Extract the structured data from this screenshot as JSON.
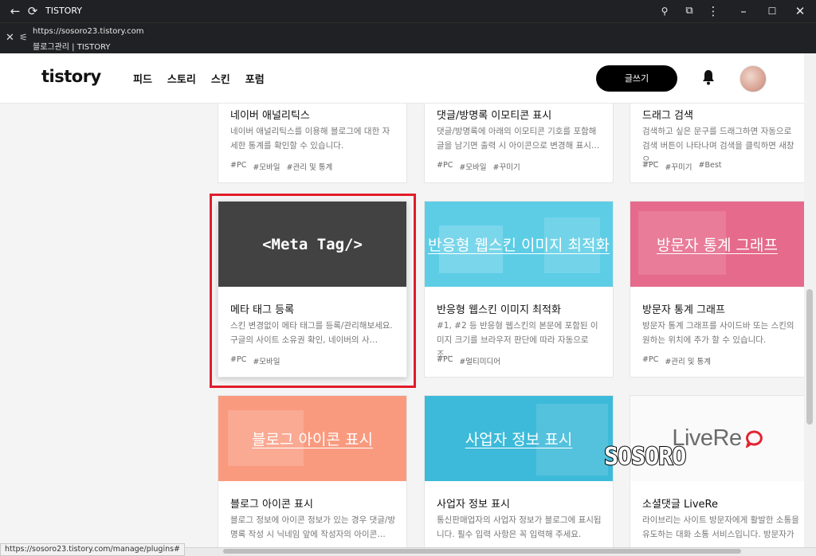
{
  "browser": {
    "window_title": "TISTORY",
    "url": "https://sosoro23.tistory.com",
    "page_title": "블로그관리 | TISTORY",
    "status_url": "https://sosoro23.tistory.com/manage/plugins#"
  },
  "header": {
    "logo": "tistory",
    "nav": [
      "피드",
      "스토리",
      "스킨",
      "포럼"
    ],
    "write_label": "글쓰기"
  },
  "cards": [
    {
      "name": "네이버 애널리틱스",
      "desc": "네이버 애널리틱스를 이용해 블로그에 대한 자세한 통계를 확인할 수 있습니다.",
      "tags": [
        "#PC",
        "#모바일",
        "#관리 및 통계"
      ]
    },
    {
      "name": "댓글/방명록 이모티콘 표시",
      "desc": "댓글/방명록에 아래의 이모티콘 기호를 포함해 글을 남기면 출력 시 아이콘으로 변경해 표시…",
      "tags": [
        "#PC",
        "#모바일",
        "#꾸미기"
      ]
    },
    {
      "name": "드래그 검색",
      "desc": "검색하고 싶은 문구를 드래그하면 자동으로 검색 버튼이 나타나며 검색을 클릭하면 새창으…",
      "tags": [
        "#PC",
        "#꾸미기",
        "#Best"
      ]
    },
    {
      "thumb": "<Meta Tag/>",
      "name": "메타 태그 등록",
      "desc": "스킨 변경없이 메타 태그를 등록/관리해보세요. 구글의 사이트 소유권 확인, 네이버의 사…",
      "tags": [
        "#PC",
        "#모바일"
      ]
    },
    {
      "thumb": "반응형 웹스킨 이미지 최적화",
      "name": "반응형 웹스킨 이미지 최적화",
      "desc": "#1, #2 등 반응형 웹스킨의 본문에 포함된 이미지 크기를 브라우저 판단에 따라 자동으로 조…",
      "tags": [
        "#PC",
        "#멀티미디어"
      ]
    },
    {
      "thumb": "방문자 통계 그래프",
      "name": "방문자 통계 그래프",
      "desc": "방문자 통계 그래프를 사이드바 또는 스킨의 원하는 위치에 추가 할 수 있습니다.",
      "tags": [
        "#PC",
        "#관리 및 통계"
      ]
    },
    {
      "thumb": "블로그 아이콘 표시",
      "name": "블로그 아이콘 표시",
      "desc": "블로그 정보에 아이콘 정보가 있는 경우 댓글/방명록 작성 시 닉네임 앞에 작성자의 아이콘…",
      "tags": []
    },
    {
      "thumb": "사업자 정보 표시",
      "name": "사업자 정보 표시",
      "desc": "통신판매업자의 사업자 정보가 블로그에 표시됩니다. 필수 입력 사항은 꼭 입력해 주세요.",
      "tags": []
    },
    {
      "thumb": "LiveRe",
      "name": "소셜댓글 LiveRe",
      "desc": "라이브리는 사이트 방문자에게 활발한 소통을 유도하는 대화 소통 서비스입니다. 방문자가 …",
      "tags": []
    }
  ],
  "colors": {
    "meta_bg": "#424242",
    "responsive_bg": "#5dcde6",
    "visitor_bg": "#e56a8b",
    "blogicon_bg": "#f99a7f",
    "business_bg": "#3dbad9",
    "livere_accent": "#e4232f",
    "highlight": "#e11d2a"
  },
  "watermark": "SOSORO"
}
